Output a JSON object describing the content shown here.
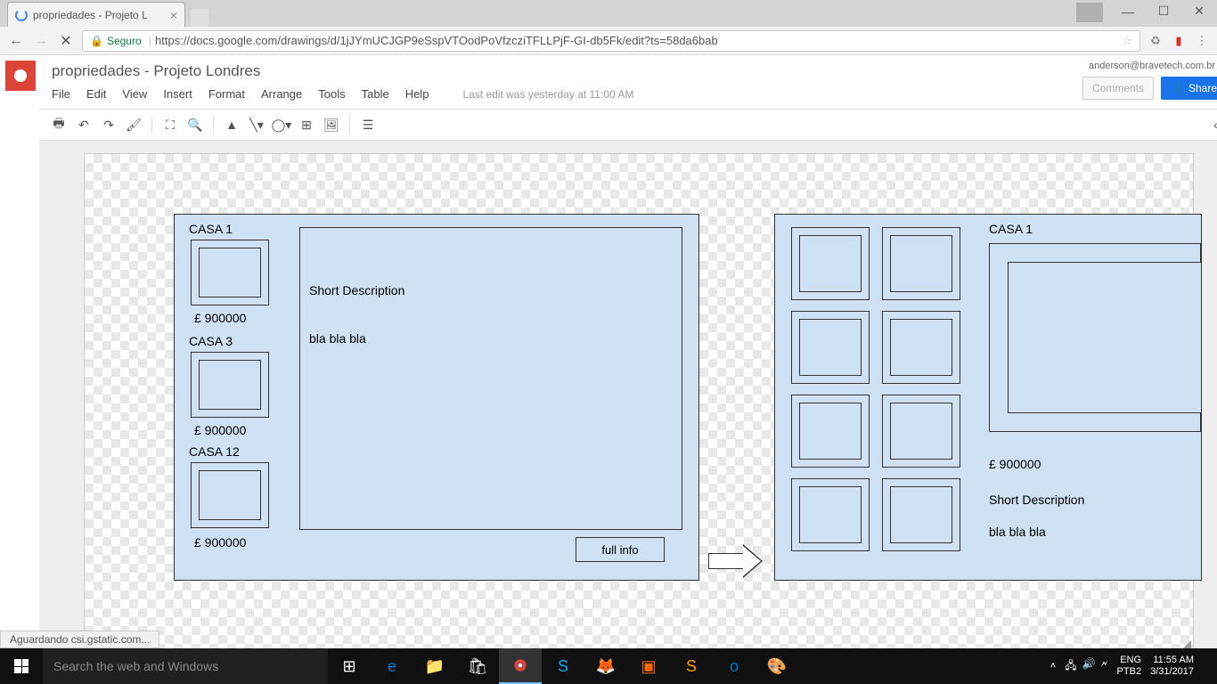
{
  "browser": {
    "tab_title": "propriedades - Projeto L",
    "url_secure_label": "Seguro",
    "url": "https://docs.google.com/drawings/d/1jJYmUCJGP9eSspVTOodPoVfzcziTFLLPjF-GI-db5Fk/edit?ts=58da6bab",
    "status": "Aguardando csi.gstatic.com..."
  },
  "doc": {
    "title": "propriedades - Projeto Londres",
    "user_email": "anderson@bravetech.com.br",
    "comments_label": "Comments",
    "share_label": "Share",
    "menus": [
      "File",
      "Edit",
      "View",
      "Insert",
      "Format",
      "Arrange",
      "Tools",
      "Table",
      "Help"
    ],
    "edit_status": "Last edit was yesterday at 11:00 AM"
  },
  "wireframe": {
    "panel1": {
      "items": [
        {
          "title": "CASA 1",
          "price": "£ 900000"
        },
        {
          "title": "CASA 3",
          "price": "£ 900000"
        },
        {
          "title": "CASA 12",
          "price": "£ 900000"
        }
      ],
      "desc_label": "Short Description",
      "desc_text": "bla bla bla",
      "button": "full info"
    },
    "panel2": {
      "title": "CASA 1",
      "price": "£ 900000",
      "desc_label": "Short Description",
      "desc_text": "bla bla bla"
    }
  },
  "taskbar": {
    "search_placeholder": "Search the web and Windows",
    "lang1": "ENG",
    "lang2": "PTB2",
    "time": "11:55 AM",
    "date": "3/31/2017"
  }
}
